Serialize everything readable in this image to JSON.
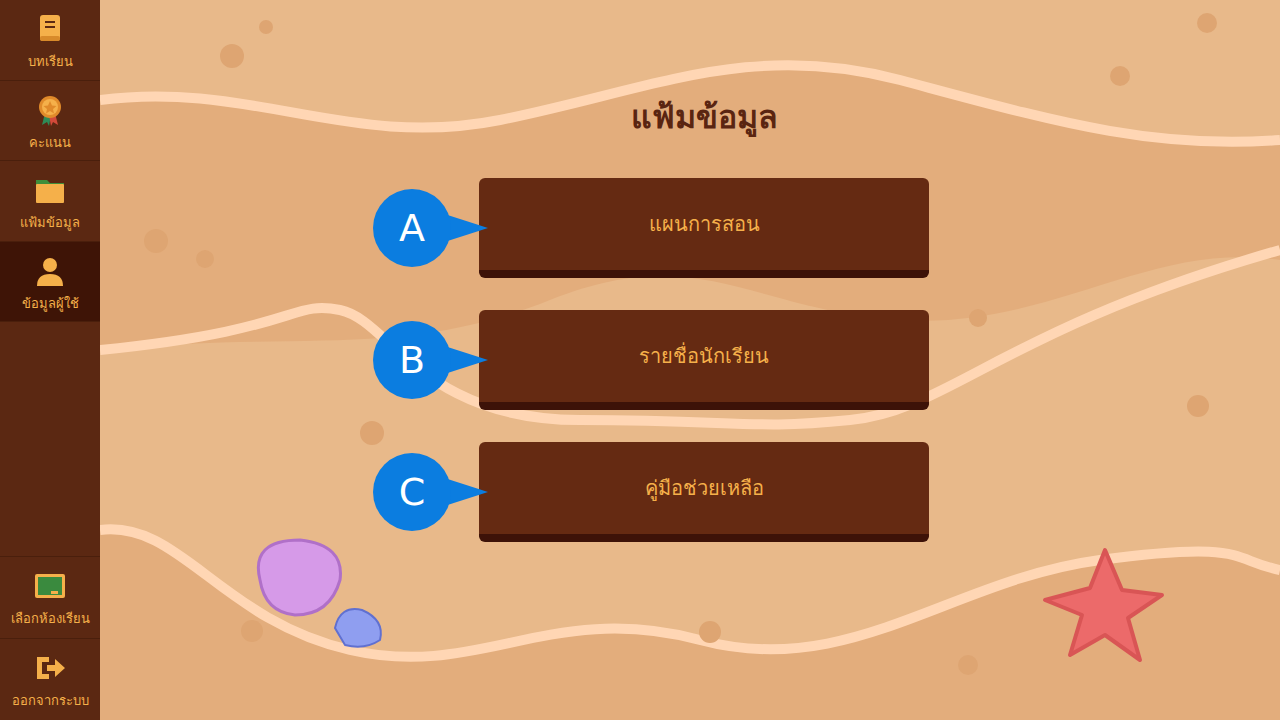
{
  "sidebar": {
    "items": [
      {
        "label": "บทเรียน",
        "selected": false
      },
      {
        "label": "คะแนน",
        "selected": false
      },
      {
        "label": "แฟ้มข้อมูล",
        "selected": false
      },
      {
        "label": "ข้อมูลผู้ใช้",
        "selected": true
      }
    ],
    "bottom_items": [
      {
        "label": "เลือกห้องเรียน"
      },
      {
        "label": "ออกจากระบบ"
      }
    ]
  },
  "title": "แฟ้มข้อมูล",
  "menu": [
    {
      "marker": "A",
      "label": "แผนการสอน"
    },
    {
      "marker": "B",
      "label": "รายชื่อนักเรียน"
    },
    {
      "marker": "C",
      "label": "คู่มือช่วยเหลือ"
    }
  ]
}
